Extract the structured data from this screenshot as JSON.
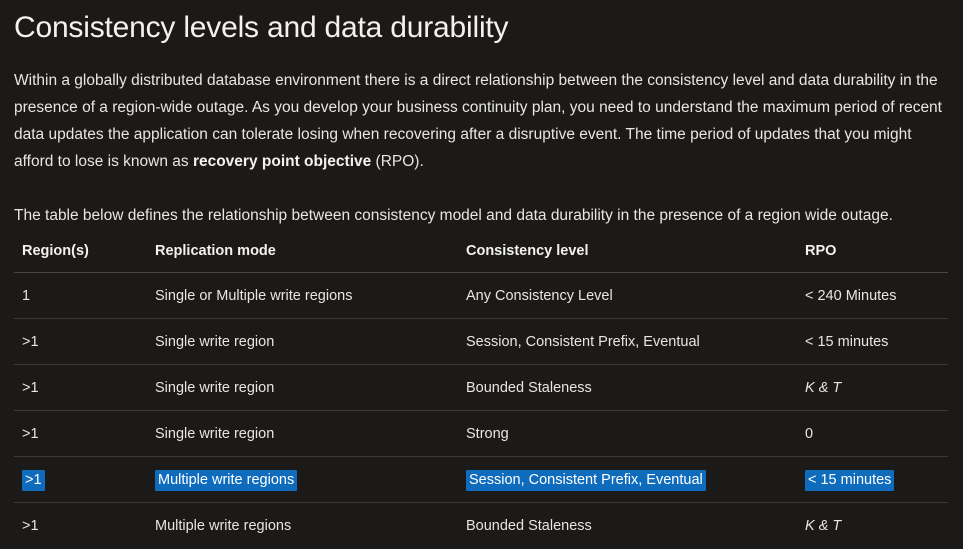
{
  "article": {
    "title": "Consistency levels and data durability",
    "intro_before_bold": "Within a globally distributed database environment there is a direct relationship between the consistency level and data durability in the presence of a region-wide outage. As you develop your business continuity plan, you need to understand the maximum period of recent data updates the application can tolerate losing when recovering after a disruptive event. The time period of updates that you might afford to lose is known as ",
    "intro_bold": "recovery point objective",
    "intro_after_bold": " (RPO).",
    "table_caption": "The table below defines the relationship between consistency model and data durability in the presence of a region wide outage."
  },
  "table": {
    "headers": {
      "region": "Region(s)",
      "mode": "Replication mode",
      "level": "Consistency level",
      "rpo": "RPO"
    },
    "rows": [
      {
        "region": "1",
        "mode": "Single or Multiple write regions",
        "level": "Any Consistency Level",
        "rpo": "< 240 Minutes",
        "rpo_italic": false,
        "selected": false
      },
      {
        "region": ">1",
        "mode": "Single write region",
        "level": "Session, Consistent Prefix, Eventual",
        "rpo": "< 15 minutes",
        "rpo_italic": false,
        "selected": false
      },
      {
        "region": ">1",
        "mode": "Single write region",
        "level": "Bounded Staleness",
        "rpo": "K & T",
        "rpo_italic": true,
        "selected": false
      },
      {
        "region": ">1",
        "mode": "Single write region",
        "level": "Strong",
        "rpo": "0",
        "rpo_italic": false,
        "selected": false
      },
      {
        "region": ">1",
        "mode": "Multiple write regions",
        "level": "Session, Consistent Prefix, Eventual",
        "rpo": "< 15 minutes",
        "rpo_italic": false,
        "selected": true
      },
      {
        "region": ">1",
        "mode": "Multiple write regions",
        "level": "Bounded Staleness",
        "rpo": "K & T",
        "rpo_italic": true,
        "selected": false
      }
    ]
  },
  "colors": {
    "background": "#1b1a19",
    "text": "#e8e6e3",
    "heading": "#f3f2f1",
    "selection_highlight": "#0f6cbd",
    "selection_text": "#ffffff",
    "header_rule": "#484644",
    "row_rule": "#3b3a39"
  }
}
